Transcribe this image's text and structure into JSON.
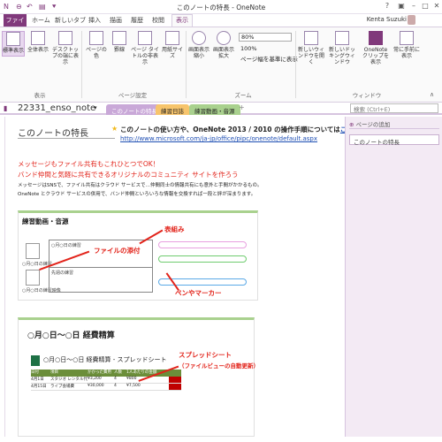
{
  "window": {
    "title": "このノートの特長 - OneNote",
    "help": "?",
    "user": "Kenta Suzuki"
  },
  "ribbon_tabs": [
    "ファイル",
    "ホーム",
    "新しいタブ",
    "挿入",
    "描画",
    "履歴",
    "校閲",
    "表示"
  ],
  "ribbon": {
    "view_group_buttons": [
      "標準表示",
      "全体表示",
      "デスクトップの端に表示"
    ],
    "view_group_label": "表示",
    "page_setup_buttons": [
      "ページの色",
      "罫線",
      "ページ タイトルの非表示",
      "用紙サイズ"
    ],
    "page_setup_label": "ページ設定",
    "zoom_buttons": [
      "画面表示縮小",
      "画面表示拡大"
    ],
    "zoom_value": "80%",
    "zoom_100": "100%",
    "zoom_fit": "ページ幅を基準に表示",
    "zoom_label": "ズーム",
    "window_buttons": [
      "新しいウィンドウを開く",
      "新しいドッキングウィンドウ",
      "OneNote クリップを表示",
      "常に手前に表示"
    ],
    "window_label": "ウィンドウ"
  },
  "notebook": {
    "name": "22331_enso_note",
    "sections": [
      {
        "label": "このノートの特長",
        "color": "#c9a8d8"
      },
      {
        "label": "練習日誌",
        "color": "#f7c46c"
      },
      {
        "label": "練習動画・音源",
        "color": "#a9d18e"
      }
    ],
    "search_placeholder": "検索 (Ctrl+E)"
  },
  "pages_pane": {
    "add_page": "ページの追加",
    "pages": [
      "このノートの特長"
    ]
  },
  "page": {
    "title": "このノートの特長",
    "howto_text": "このノートの使い方や、OneNote 2013 / 2010 の操作手順については",
    "howto_link": "こちら",
    "url": "http://www.microsoft.com/ja-jp/office/pipc/onenote/default.aspx",
    "red_line1": "メッセージもファイル共有もこれひとつでOK！",
    "red_line2": "バンド仲間と気軽に共有できるオリジナルのコミュニティ サイトを作ろう",
    "body1": "メッセージはSNSで、ファイル共有はクラウド サービスで…仲間同士の情報共有にも意外と手間がかかるもの。",
    "body2": "OneNote とクラウド サービスの併用で、バンド仲間といろいろな情報を交換すれば一段と絆が深まります。",
    "fig1_title": "練習動画・音源",
    "fig1_notes": [
      "ファイルの添付",
      "表組み",
      "ペンやマーカー"
    ],
    "fig1_labels": [
      "○月○日の練習",
      "先週の練習",
      "○月○日の練習映像"
    ],
    "fig2_title": "○月○日～○日 経費精算",
    "fig2_subtitle": "○月○日～○日 経費精算 - スプレッドシート",
    "fig2_note_line1": "スプレッドシート",
    "fig2_note_line2": "（ファイルビューの自動更新）",
    "table_header": [
      "日付",
      "項目",
      "かかった費用",
      "人数",
      "1人あたりの金額",
      ""
    ],
    "table_rows": [
      [
        "4月1日",
        "スタジオ レンタル代",
        "¥3,200",
        "4",
        "¥800",
        ""
      ],
      [
        "4月15日",
        "ライブ会場費",
        "¥30,000",
        "4",
        "¥7,500",
        ""
      ]
    ]
  }
}
